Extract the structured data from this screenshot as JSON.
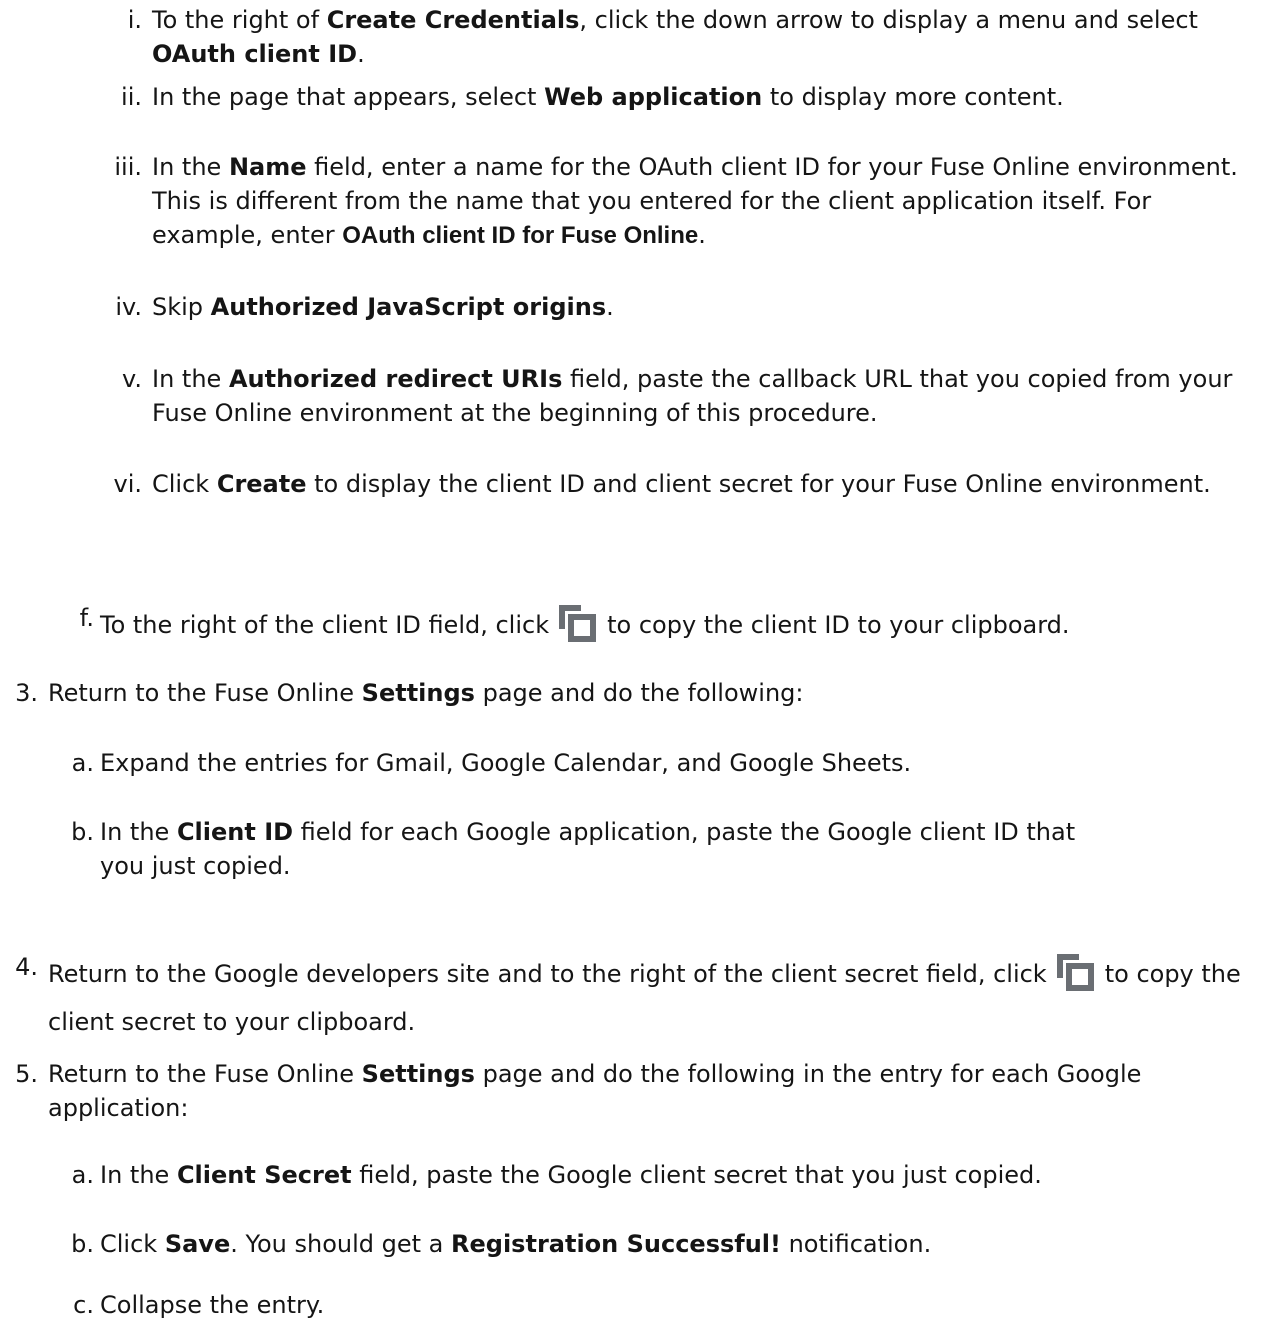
{
  "steps": {
    "e_i": {
      "marker": "i.",
      "t1": "To the right of ",
      "b1": "Create Credentials",
      "t2": ", click the down arrow to display a menu and select ",
      "b2": "OAuth client ID",
      "t3": "."
    },
    "e_ii": {
      "marker": "ii.",
      "t1": "In the page that appears, select ",
      "b1": "Web application",
      "t2": " to display more content."
    },
    "e_iii": {
      "marker": "iii.",
      "t1": "In the ",
      "b1": "Name",
      "t2": " field, enter a name for the OAuth client ID for your Fuse Online environment. This is different from the name that you entered for the client application itself. For example, enter ",
      "b2": "OAuth client ID for Fuse Online",
      "t3": "."
    },
    "e_iv": {
      "marker": "iv.",
      "t1": "Skip ",
      "b1": "Authorized JavaScript origins",
      "t2": "."
    },
    "e_v": {
      "marker": "v.",
      "t1": "In the ",
      "b1": "Authorized redirect URIs",
      "t2": " field, paste the callback URL that you copied from your Fuse Online environment at the beginning of this procedure."
    },
    "e_vi": {
      "marker": "vi.",
      "t1": "Click ",
      "b1": "Create",
      "t2": " to display the client ID and client secret for your Fuse Online environment."
    },
    "f": {
      "marker": "f.",
      "t1": "To the right of the client ID field, click",
      "t2": "to copy the client ID to your clipboard."
    },
    "s3": {
      "marker": "3.",
      "t1": "Return to the Fuse Online ",
      "b1": "Settings",
      "t2": " page and do the following:"
    },
    "s3a": {
      "marker": "a.",
      "t1": "Expand the entries for Gmail, Google Calendar, and Google Sheets."
    },
    "s3b": {
      "marker": "b.",
      "t1": "In the ",
      "b1": "Client ID",
      "t2": " field for each Google application, paste the Google client ID that you just copied."
    },
    "s4": {
      "marker": "4.",
      "t1": "Return to the Google developers site and to the right of the client secret field, click",
      "t2": "to copy the client secret to your clipboard."
    },
    "s5": {
      "marker": "5.",
      "t1": "Return to the Fuse Online ",
      "b1": "Settings",
      "t2": " page and do the following in the entry for each Google application:"
    },
    "s5a": {
      "marker": "a.",
      "t1": "In the ",
      "b1": "Client Secret",
      "t2": " field, paste the Google client secret that you just copied."
    },
    "s5b": {
      "marker": "b.",
      "t1": "Click ",
      "b1": "Save",
      "t2": ". You should get a ",
      "b2": "Registration Successful!",
      "t3": " notification."
    },
    "s5c": {
      "marker": "c.",
      "t1": "Collapse the entry."
    }
  },
  "icons": {
    "copy": "copy-icon"
  },
  "colors": {
    "text": "#151515",
    "icon": "#6a6e73"
  }
}
